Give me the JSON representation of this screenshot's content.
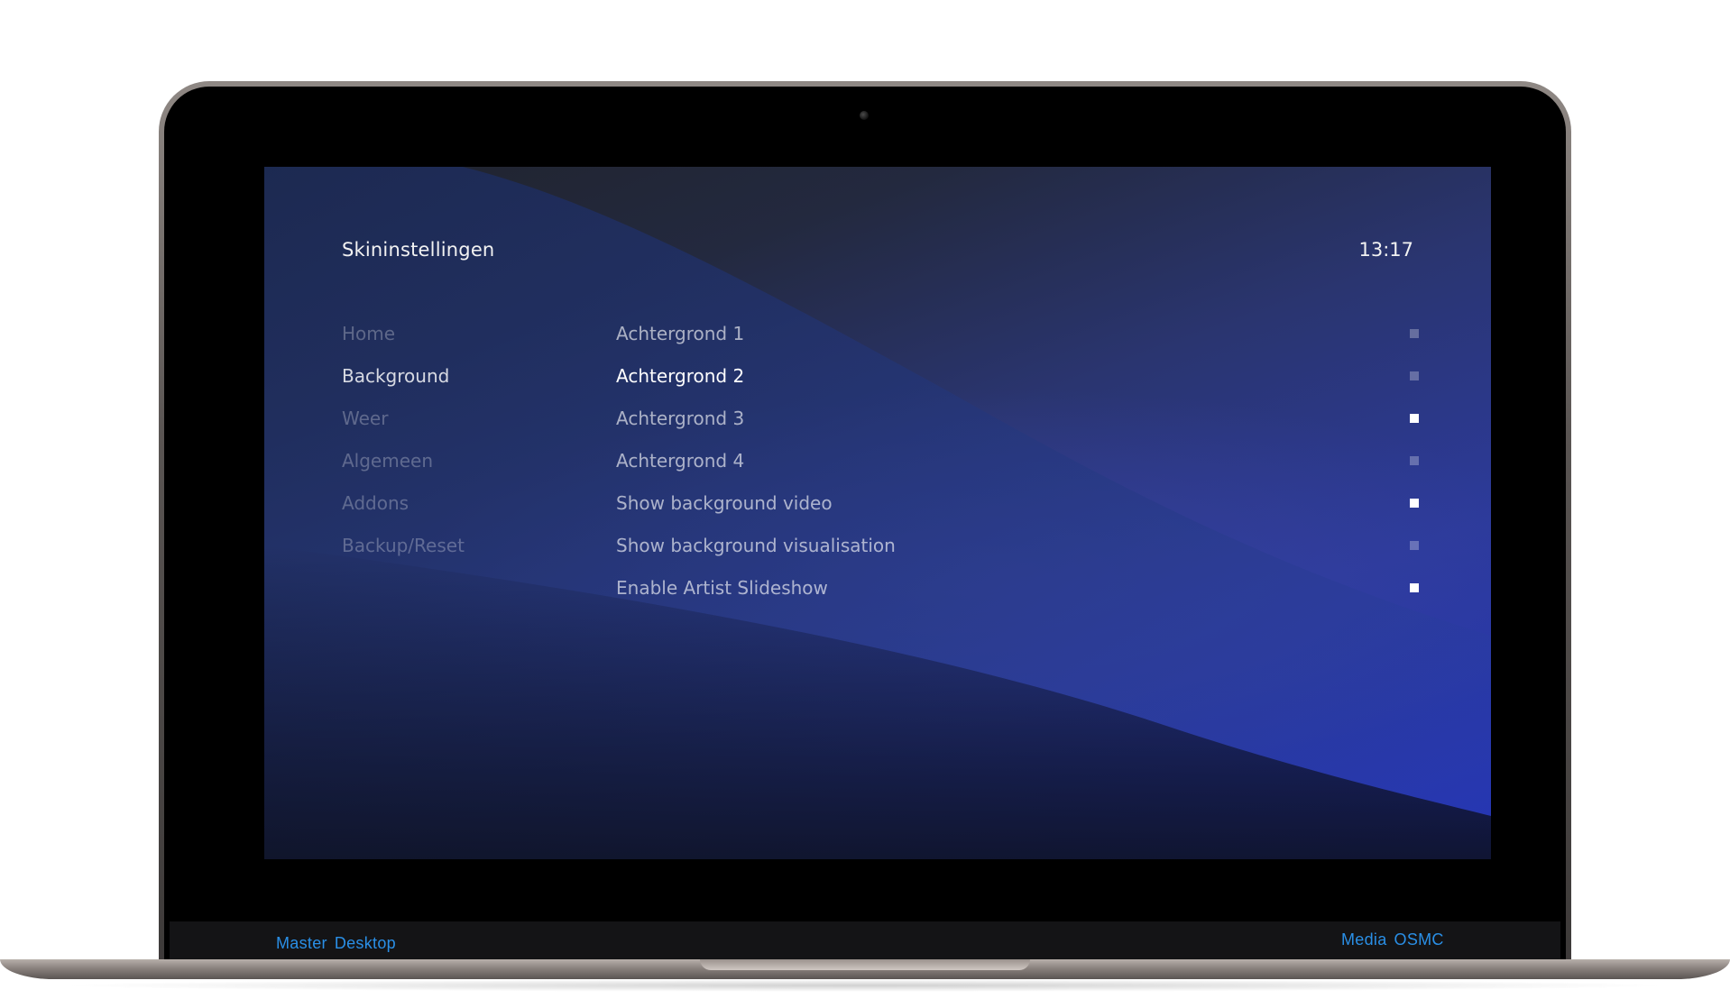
{
  "screen": {
    "title": "Skininstellingen",
    "clock": "13:17"
  },
  "sidebar": {
    "items": [
      {
        "label": "Home",
        "active": false
      },
      {
        "label": "Background",
        "active": true
      },
      {
        "label": "Weer",
        "active": false
      },
      {
        "label": "Algemeen",
        "active": false
      },
      {
        "label": "Addons",
        "active": false
      },
      {
        "label": "Backup/Reset",
        "active": false
      }
    ]
  },
  "settings": {
    "items": [
      {
        "label": "Achtergrond 1",
        "enabled": false,
        "focused": false
      },
      {
        "label": "Achtergrond 2",
        "enabled": false,
        "focused": true
      },
      {
        "label": "Achtergrond 3",
        "enabled": true,
        "focused": false
      },
      {
        "label": "Achtergrond 4",
        "enabled": false,
        "focused": false
      },
      {
        "label": "Show background video",
        "enabled": true,
        "focused": false
      },
      {
        "label": "Show background visualisation",
        "enabled": false,
        "focused": false
      },
      {
        "label": "Enable Artist Slideshow",
        "enabled": true,
        "focused": false
      }
    ]
  },
  "chin": {
    "left": [
      "Master",
      "Desktop"
    ],
    "right": [
      "Media",
      "OSMC"
    ]
  },
  "colors": {
    "accent": "#2a8fe6",
    "screen_dark": "#20232c",
    "screen_blue": "#2433b8"
  }
}
